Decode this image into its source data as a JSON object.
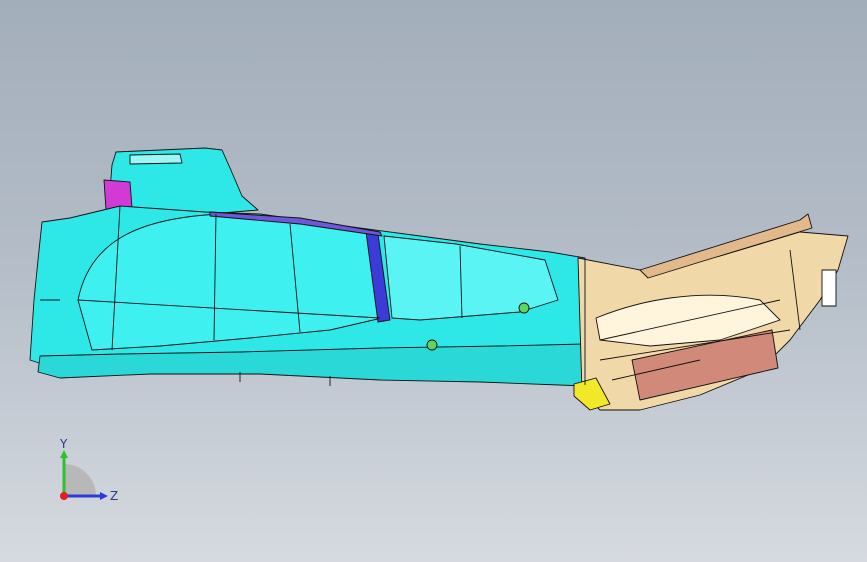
{
  "viewport": {
    "background_top": "#a3aebb",
    "background_bottom": "#d6dae0"
  },
  "model": {
    "main_body_color": "#2ee8e8",
    "nose_color": "#f1d8a8",
    "inner_shell_color": "#ffffff",
    "panel_color": "#d18a7a",
    "accent_purple": "#3d3bd8",
    "accent_magenta": "#d23ad6",
    "accent_yellow": "#f2e82a",
    "fastener_color": "#5fd65f",
    "edge_color": "#111111"
  },
  "triad": {
    "y_label": "Y",
    "z_label": "Z",
    "y_axis_color": "#2fbf2f",
    "z_axis_color": "#2a3adb",
    "x_axis_color": "#e02020"
  }
}
